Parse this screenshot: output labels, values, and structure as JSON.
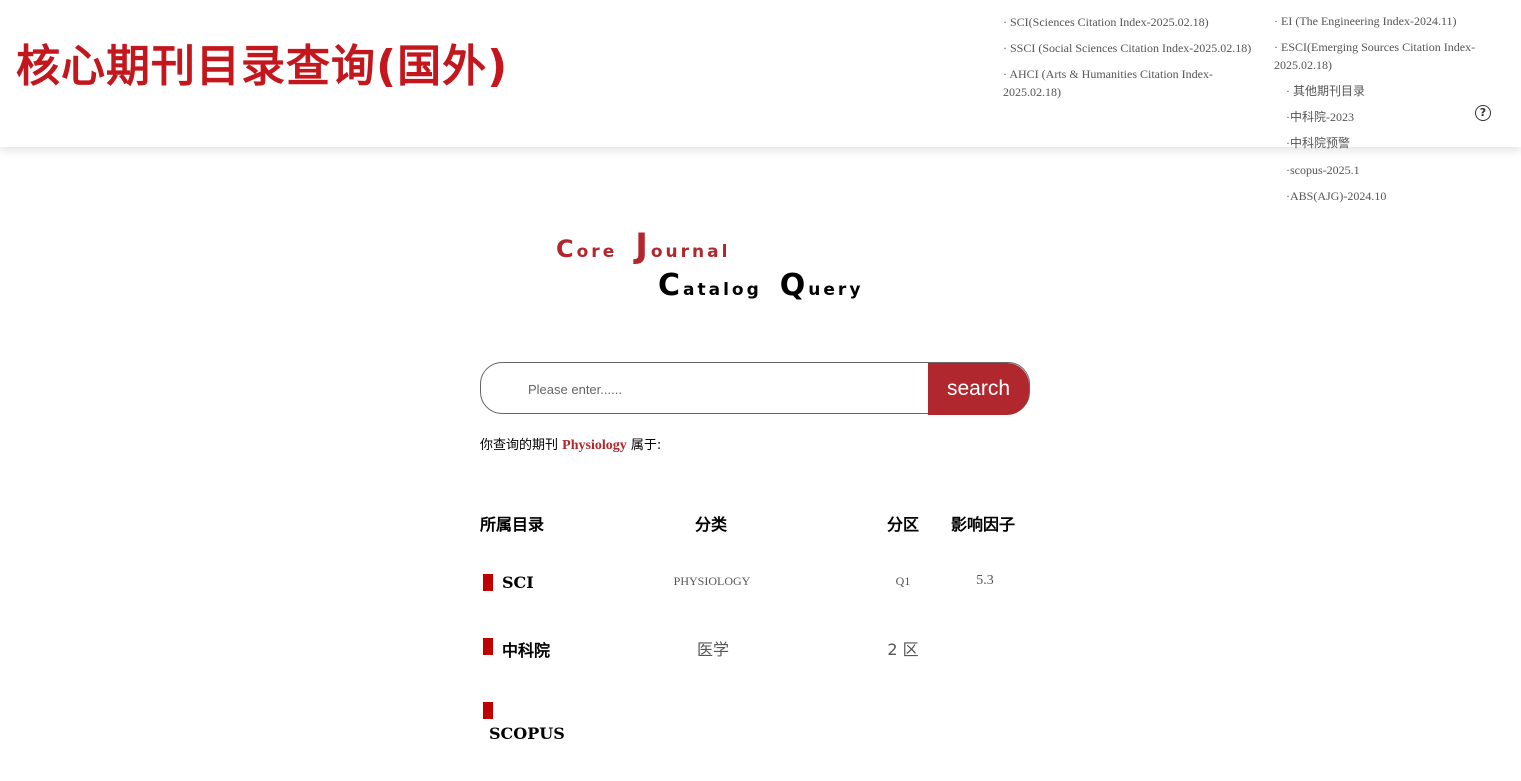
{
  "header": {
    "title": "核心期刊目录查询(国外)",
    "nav_col1": [
      "· SCI(Sciences Citation Index-2025.02.18)",
      "· SSCI (Social Sciences Citation Index-2025.02.18)",
      "· AHCI (Arts & Humanities Citation Index-",
      "2025.02.18)"
    ],
    "nav_col2": [
      "· EI (The Engineering Index-2024.11)",
      "· ESCI(Emerging Sources Citation Index-",
      "2025.02.18)",
      "· 其他期刊目录",
      "·中科院-2023",
      "·中科院预警",
      "·scopus-2025.1",
      "·ABS(AJG)-2024.10"
    ],
    "help_icon": "question-circle-icon",
    "help_glyph": "?"
  },
  "logo": {
    "line1_a_cap": "C",
    "line1_a_rest": "ore",
    "line1_b_cap": "J",
    "line1_b_rest": "ournal",
    "line2_a_cap": "C",
    "line2_a_rest": "atalog",
    "line2_b_cap": "Q",
    "line2_b_rest": "uery"
  },
  "search": {
    "placeholder": "Please enter......",
    "value": "",
    "button_label": "search"
  },
  "result": {
    "prefix": "你查询的期刊",
    "journal": "Physiology",
    "suffix": "属于:"
  },
  "table": {
    "headers": [
      "所属目录",
      "分类",
      "分区",
      "影响因子"
    ],
    "rows": [
      {
        "catalog": "SCI",
        "category": "PHYSIOLOGY",
        "zone": "Q1",
        "impact": "5.3"
      },
      {
        "catalog": "中科院",
        "category": "医学",
        "zone": "2 区",
        "impact": ""
      },
      {
        "catalog": "SCOPUS",
        "category": "",
        "zone": "",
        "impact": ""
      }
    ]
  },
  "colors": {
    "title_red": "#c4171d",
    "accent_red": "#b0272d",
    "marker_red": "#c00000"
  }
}
